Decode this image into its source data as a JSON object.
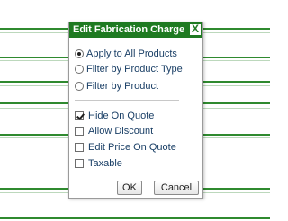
{
  "dialog": {
    "title": "Edit Fabrication Charge",
    "close_label": "X",
    "filter_options": [
      {
        "label": "Apply to All Products",
        "checked": true
      },
      {
        "label": "Filter by Product Type",
        "checked": false
      },
      {
        "label": "Filter by Product",
        "checked": false
      }
    ],
    "checkbox_options": [
      {
        "label": "Hide On Quote",
        "checked": true
      },
      {
        "label": "Allow Discount",
        "checked": false
      },
      {
        "label": "Edit Price On Quote",
        "checked": false
      },
      {
        "label": "Taxable",
        "checked": false
      }
    ],
    "ok_label": "OK",
    "cancel_label": "Cancel"
  },
  "colors": {
    "titlebar": "#1e7a21",
    "label_text": "#1a3f66",
    "background_lines": "#2f8a2f"
  }
}
